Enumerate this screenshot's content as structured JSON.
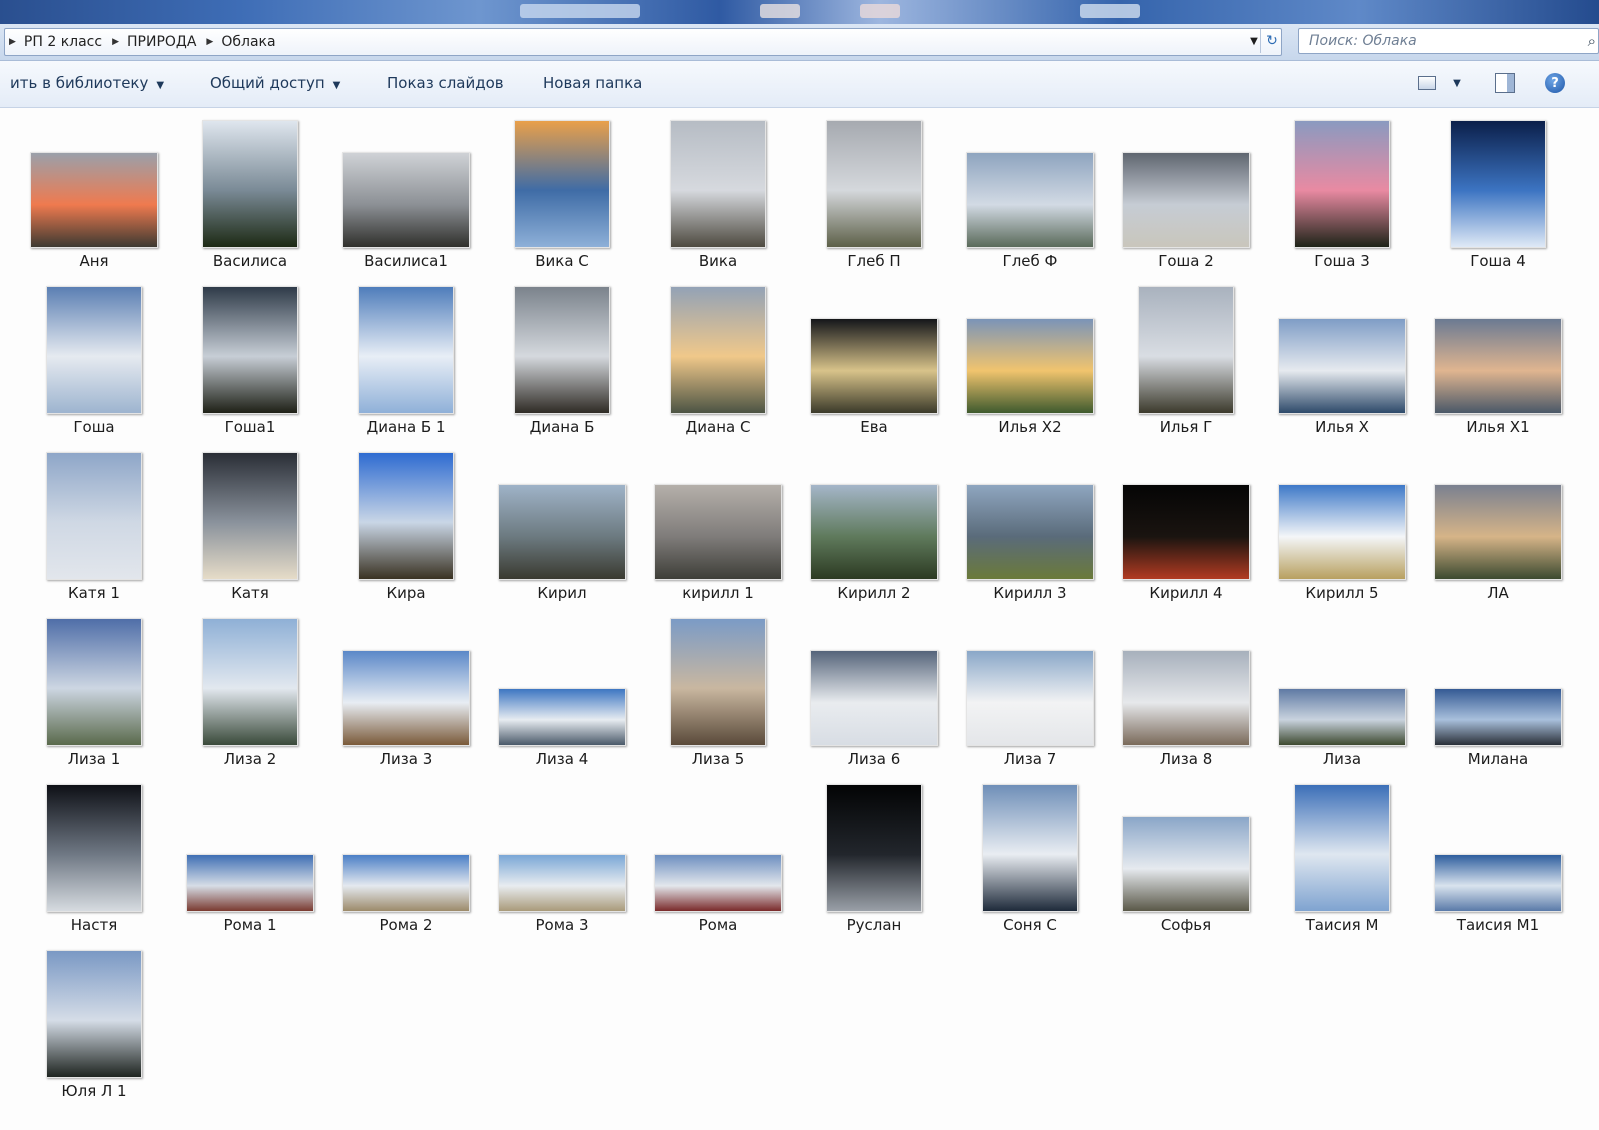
{
  "breadcrumb": [
    "РП 2 класс",
    "ПРИРОДА",
    "Облака"
  ],
  "search": {
    "placeholder": "Поиск: Облака"
  },
  "toolbar": {
    "add_to_library": "ить в библиотеку",
    "share": "Общий доступ",
    "slideshow": "Показ слайдов",
    "new_folder": "Новая папка"
  },
  "icons": [
    "dropdown-icon",
    "refresh-icon",
    "search-icon",
    "view-icon",
    "preview-pane-icon",
    "help-icon"
  ],
  "files": [
    {
      "name": "Аня",
      "shape": "landscape",
      "colors": [
        "#9aa0aa",
        "#ef7a4f",
        "#3d3a32"
      ]
    },
    {
      "name": "Василиса",
      "shape": "portrait",
      "colors": [
        "#dfe6ee",
        "#7a8a96",
        "#1d2a14"
      ]
    },
    {
      "name": "Василиса1",
      "shape": "landscape",
      "colors": [
        "#cfd2d6",
        "#8c9095",
        "#30302c"
      ]
    },
    {
      "name": "Вика С",
      "shape": "portrait",
      "colors": [
        "#e9a04a",
        "#3f6ca6",
        "#8eb0d8"
      ]
    },
    {
      "name": "Вика",
      "shape": "portrait",
      "colors": [
        "#b6bcc4",
        "#d6d9de",
        "#4e4a40"
      ]
    },
    {
      "name": "Глеб П",
      "shape": "portrait",
      "colors": [
        "#a6aab0",
        "#d5d8dc",
        "#5d6048"
      ]
    },
    {
      "name": "Глеб Ф",
      "shape": "landscape",
      "colors": [
        "#8ea4bf",
        "#d2dae4",
        "#5a6a5a"
      ]
    },
    {
      "name": "Гоша 2",
      "shape": "landscape",
      "colors": [
        "#5f6670",
        "#c6ccd4",
        "#c9c6bc"
      ]
    },
    {
      "name": "Гоша 3",
      "shape": "portrait",
      "colors": [
        "#8a9ac0",
        "#e98aa2",
        "#1e2418"
      ]
    },
    {
      "name": "Гоша 4",
      "shape": "portrait",
      "colors": [
        "#0b1f4a",
        "#3c74c2",
        "#dfe9f6"
      ]
    },
    {
      "name": "Гоша",
      "shape": "portrait",
      "colors": [
        "#5b7fb3",
        "#e6eaf0",
        "#9db4cf"
      ]
    },
    {
      "name": "Гоша1",
      "shape": "portrait",
      "colors": [
        "#2f3b49",
        "#c7ced6",
        "#1e2016"
      ]
    },
    {
      "name": "Диана Б 1",
      "shape": "portrait",
      "colors": [
        "#4f7dbb",
        "#e8eef6",
        "#8fb0d8"
      ]
    },
    {
      "name": "Диана Б",
      "shape": "portrait",
      "colors": [
        "#7b838c",
        "#d5d9de",
        "#2f2b25"
      ]
    },
    {
      "name": "Диана С",
      "shape": "portrait",
      "colors": [
        "#93a2b6",
        "#f0c88a",
        "#4c5444"
      ]
    },
    {
      "name": "Ева",
      "shape": "landscape",
      "colors": [
        "#14161a",
        "#d8c38a",
        "#3b3a2a"
      ]
    },
    {
      "name": "Илья  Х2",
      "shape": "landscape",
      "colors": [
        "#7b94b8",
        "#f1c46e",
        "#3f5a2e"
      ]
    },
    {
      "name": "Илья Г",
      "shape": "portrait",
      "colors": [
        "#a9b2be",
        "#d9dde3",
        "#3c3a2c"
      ]
    },
    {
      "name": "Илья Х",
      "shape": "landscape",
      "colors": [
        "#7f9dc6",
        "#e6eaef",
        "#2e4a6a"
      ]
    },
    {
      "name": "Илья Х1",
      "shape": "landscape",
      "colors": [
        "#6b7a92",
        "#e0b590",
        "#4a5868"
      ]
    },
    {
      "name": "Катя 1",
      "shape": "portrait",
      "colors": [
        "#8ea6c8",
        "#cfd8e4",
        "#e2e6ec"
      ]
    },
    {
      "name": "Катя",
      "shape": "portrait",
      "colors": [
        "#2a2e36",
        "#8a929c",
        "#e6dcc8"
      ]
    },
    {
      "name": "Кира",
      "shape": "portrait",
      "colors": [
        "#2e6bd1",
        "#c9d6e6",
        "#3a3222"
      ]
    },
    {
      "name": "Кирил",
      "shape": "landscape",
      "colors": [
        "#9fb3c8",
        "#6c7a80",
        "#3a3a30"
      ]
    },
    {
      "name": "кирилл 1",
      "shape": "landscape",
      "colors": [
        "#b5b0aa",
        "#7f7c7a",
        "#3e3e38"
      ]
    },
    {
      "name": "Кирилл 2",
      "shape": "landscape",
      "colors": [
        "#a5b6c9",
        "#5f7a5c",
        "#2c3a22"
      ]
    },
    {
      "name": "Кирилл 3",
      "shape": "landscape",
      "colors": [
        "#8fa6c0",
        "#5a6b7a",
        "#6b7a3a"
      ]
    },
    {
      "name": "Кирилл 4",
      "shape": "landscape",
      "colors": [
        "#050505",
        "#1a1410",
        "#b23b22"
      ]
    },
    {
      "name": "Кирилл 5",
      "shape": "landscape",
      "colors": [
        "#3e79c8",
        "#f4f6f8",
        "#b8a060"
      ]
    },
    {
      "name": "ЛА",
      "shape": "landscape",
      "colors": [
        "#7a8090",
        "#d6b488",
        "#3c4a30"
      ]
    },
    {
      "name": "Лиза 1",
      "shape": "portrait",
      "colors": [
        "#4f6ea8",
        "#cdd6e2",
        "#5a6a4c"
      ]
    },
    {
      "name": "Лиза 2",
      "shape": "portrait",
      "colors": [
        "#8fb0d6",
        "#e2e8ef",
        "#3a4a3a"
      ]
    },
    {
      "name": "Лиза 3",
      "shape": "landscape",
      "colors": [
        "#5b88c8",
        "#e8edf3",
        "#7a5a3a"
      ]
    },
    {
      "name": "Лиза 4",
      "shape": "wide",
      "colors": [
        "#3d76c2",
        "#e7ecf1",
        "#4b5a6a"
      ]
    },
    {
      "name": "Лиза 5",
      "shape": "portrait",
      "colors": [
        "#7b9bc6",
        "#c9b7a0",
        "#5a4a3a"
      ]
    },
    {
      "name": "Лиза 6",
      "shape": "landscape",
      "colors": [
        "#55647a",
        "#e9ecef",
        "#d8dde4"
      ]
    },
    {
      "name": "Лиза 7",
      "shape": "landscape",
      "colors": [
        "#8aa7c8",
        "#f2f3f4",
        "#e4e6e9"
      ]
    },
    {
      "name": "Лиза 8",
      "shape": "landscape",
      "colors": [
        "#a7b0bc",
        "#e6e8eb",
        "#7a6a5a"
      ]
    },
    {
      "name": "Лиза",
      "shape": "wide",
      "colors": [
        "#5f7aa4",
        "#c9d3de",
        "#3e4a30"
      ]
    },
    {
      "name": "Милана",
      "shape": "wide",
      "colors": [
        "#345a94",
        "#a9c0dc",
        "#2a3038"
      ]
    },
    {
      "name": "Настя",
      "shape": "portrait",
      "colors": [
        "#0e1016",
        "#6f7884",
        "#d6dbe0"
      ]
    },
    {
      "name": "Рома 1",
      "shape": "wide",
      "colors": [
        "#3f6fb4",
        "#d6dde6",
        "#7a3a30"
      ]
    },
    {
      "name": "Рома 2",
      "shape": "wide",
      "colors": [
        "#4a7fc6",
        "#e4e9ef",
        "#9c8a6a"
      ]
    },
    {
      "name": "Рома 3",
      "shape": "wide",
      "colors": [
        "#7aa7d6",
        "#e8ecf0",
        "#a99a7a"
      ]
    },
    {
      "name": "Рома",
      "shape": "wide",
      "colors": [
        "#6d8fc0",
        "#e3e7ec",
        "#7a2a2a"
      ]
    },
    {
      "name": "Руслан",
      "shape": "portrait",
      "colors": [
        "#030405",
        "#22262c",
        "#9aa0a8"
      ]
    },
    {
      "name": "Соня С",
      "shape": "portrait",
      "colors": [
        "#6f8fb8",
        "#e9edf2",
        "#1e2a3a"
      ]
    },
    {
      "name": "Софья",
      "shape": "landscape",
      "colors": [
        "#8aa6c8",
        "#e6eaef",
        "#5a5848"
      ]
    },
    {
      "name": "Таисия М",
      "shape": "portrait",
      "colors": [
        "#3c6fb8",
        "#dfe7f0",
        "#7fa3d0"
      ]
    },
    {
      "name": "Таисия М1",
      "shape": "wide",
      "colors": [
        "#2e5e9e",
        "#d9e3ee",
        "#5a7aa8"
      ]
    },
    {
      "name": "Юля Л 1",
      "shape": "portrait",
      "colors": [
        "#7a98c4",
        "#d5dde7",
        "#1e2420"
      ]
    }
  ]
}
